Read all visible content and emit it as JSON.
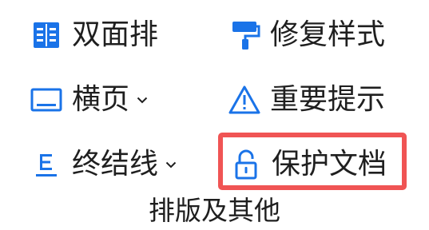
{
  "group": {
    "title": "排版及其他",
    "items": [
      {
        "label": "双面排",
        "icon": "double-page-icon",
        "dropdown": false
      },
      {
        "label": "修复样式",
        "icon": "paint-roller-icon",
        "dropdown": false
      },
      {
        "label": "横页",
        "icon": "landscape-page-icon",
        "dropdown": true
      },
      {
        "label": "重要提示",
        "icon": "warning-icon",
        "dropdown": false
      },
      {
        "label": "终结线",
        "icon": "end-line-icon",
        "dropdown": true
      },
      {
        "label": "保护文档",
        "icon": "unlock-icon",
        "dropdown": false,
        "highlighted": true
      }
    ]
  },
  "colors": {
    "icon_blue": "#1a73e8",
    "highlight": "#f05454",
    "text": "#1f1f1f"
  }
}
